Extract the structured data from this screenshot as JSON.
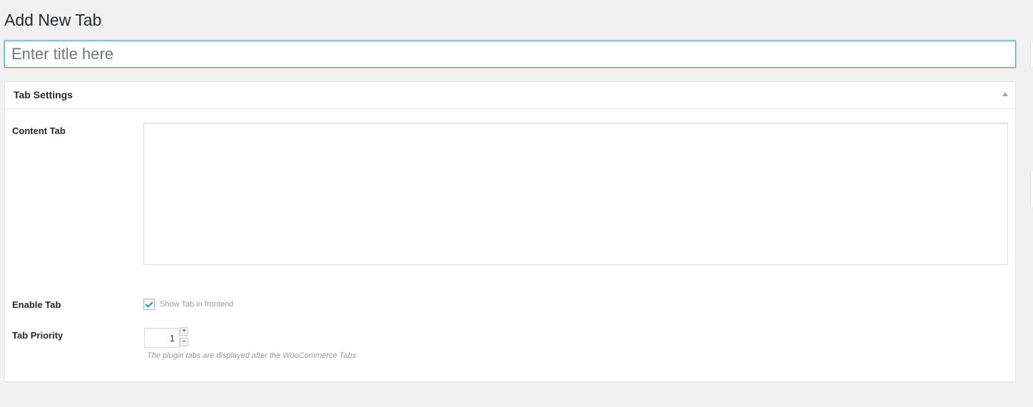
{
  "page": {
    "title": "Add New Tab"
  },
  "title_field": {
    "placeholder": "Enter title here",
    "value": ""
  },
  "tab_settings": {
    "heading": "Tab Settings",
    "toggle_icon": "triangle-up-icon",
    "content_tab": {
      "label": "Content Tab",
      "value": ""
    },
    "enable_tab": {
      "label": "Enable Tab",
      "checkbox_label": "Show Tab in frontend",
      "checked": true,
      "check_color": "#1e8cbe"
    },
    "tab_priority": {
      "label": "Tab Priority",
      "value": "1",
      "increment_symbol": "+",
      "decrement_symbol": "−",
      "description": "The plugin tabs are displayed after the WooCommerce Tabs"
    }
  },
  "colors": {
    "background": "#f1f1f1",
    "focus_border": "#5b9dd9",
    "text": "#23282d",
    "muted_text": "#999999"
  }
}
